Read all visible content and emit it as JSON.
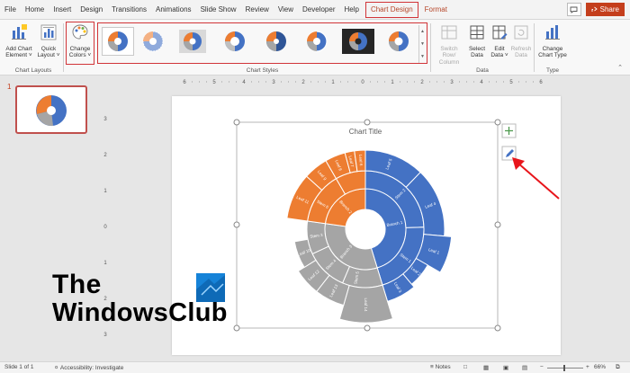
{
  "tabs": [
    "File",
    "Home",
    "Insert",
    "Design",
    "Transitions",
    "Animations",
    "Slide Show",
    "Review",
    "View",
    "Developer",
    "Help",
    "Chart Design",
    "Format"
  ],
  "active_tab": "Chart Design",
  "share_label": "Share",
  "ribbon": {
    "chart_layouts": {
      "label": "Chart Layouts",
      "add_chart_element": [
        "Add Chart",
        "Element ˅"
      ],
      "quick_layout": [
        "Quick",
        "Layout ˅"
      ]
    },
    "change_colors": [
      "Change",
      "Colors ˅"
    ],
    "chart_styles_label": "Chart Styles",
    "data": {
      "label": "Data",
      "switch_row_column": [
        "Switch Row/",
        "Column"
      ],
      "select_data": [
        "Select",
        "Data"
      ],
      "edit_data": [
        "Edit",
        "Data ˅"
      ],
      "refresh_data": [
        "Refresh",
        "Data"
      ]
    },
    "type": {
      "label": "Type",
      "change_chart_type": [
        "Change",
        "Chart Type"
      ]
    }
  },
  "ruler_h": [
    "6",
    "5",
    "4",
    "3",
    "2",
    "1",
    "0",
    "1",
    "2",
    "3",
    "4",
    "5",
    "6"
  ],
  "ruler_v": [
    "3",
    "2",
    "1",
    "0",
    "1",
    "2",
    "3"
  ],
  "slide_number": "1",
  "chart": {
    "title": "Chart Title",
    "branches": [
      {
        "name": "Branch 1",
        "color": "#4472c4"
      },
      {
        "name": "Branch 2",
        "color": "#ed7d31"
      },
      {
        "name": "Branch 3",
        "color": "#a5a5a5"
      }
    ],
    "labels": {
      "leaf5": "Leaf 5",
      "leaf4": "Leaf 4",
      "stem2": "Stem 2",
      "branch1": "Branch 1",
      "stem1": "Stem 1",
      "leaf1": "Leaf 1",
      "leaf2": "Leaf 2",
      "leaf3": "Leaf 3",
      "leaf6": "Leaf 6",
      "leaf7": "Leaf 7",
      "leaf8": "Leaf 8",
      "leaf9": "Leaf 9",
      "leaf10": "Leaf 10",
      "leaf11": "Leaf 11",
      "leaf12": "Leaf 12",
      "leaf13": "Leaf 13",
      "leaf14": "Leaf 14",
      "stem3": "Stem 3",
      "stem4": "Stem 4",
      "stem5": "Stem 5",
      "stem6": "Stem 6",
      "branch2": "Branch 2",
      "branch3": "Branch 3"
    }
  },
  "status": {
    "slide": "Slide 1 of 1",
    "accessibility": "Accessibility: Investigate",
    "notes": "Notes",
    "zoom": "66%"
  },
  "watermark": {
    "line1": "The",
    "line2": "WindowsClub"
  },
  "colors": {
    "accent": "#d13438",
    "blue": "#4472c4",
    "orange": "#ed7d31",
    "gray": "#a5a5a5",
    "share": "#c43e1c"
  }
}
